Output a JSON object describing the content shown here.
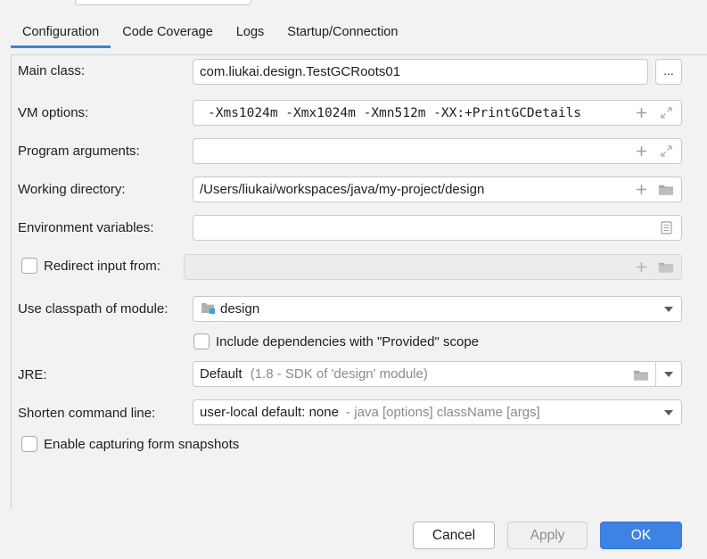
{
  "tabs": [
    {
      "label": "Configuration"
    },
    {
      "label": "Code Coverage"
    },
    {
      "label": "Logs"
    },
    {
      "label": "Startup/Connection"
    }
  ],
  "form": {
    "main_class": {
      "label": "Main class:",
      "value": "com.liukai.design.TestGCRoots01",
      "browse": "..."
    },
    "vm_options": {
      "label": "VM options:",
      "value": "-Xms1024m -Xmx1024m -Xmn512m -XX:+PrintGCDetails"
    },
    "program_args": {
      "label": "Program arguments:",
      "value": ""
    },
    "working_dir": {
      "label": "Working directory:",
      "value": "/Users/liukai/workspaces/java/my-project/design"
    },
    "env_vars": {
      "label": "Environment variables:",
      "value": ""
    },
    "redirect_input": {
      "label": "Redirect input from:",
      "checked": false,
      "value": ""
    },
    "classpath_module": {
      "label": "Use classpath of module:",
      "value": "design"
    },
    "include_provided": {
      "label": "Include dependencies with \"Provided\" scope",
      "checked": false
    },
    "jre": {
      "label": "JRE:",
      "value": "Default",
      "hint": "(1.8 - SDK of 'design' module)"
    },
    "shorten_cmd": {
      "label": "Shorten command line:",
      "value": "user-local default: none",
      "hint": "- java [options] className [args]"
    },
    "capture_snapshots": {
      "label": "Enable capturing form snapshots",
      "checked": false
    }
  },
  "buttons": {
    "cancel": "Cancel",
    "apply": "Apply",
    "ok": "OK"
  },
  "colors": {
    "accent": "#3e82e4",
    "icon_gray": "#a0a0a0",
    "module_icon": "#2ea6d8"
  }
}
